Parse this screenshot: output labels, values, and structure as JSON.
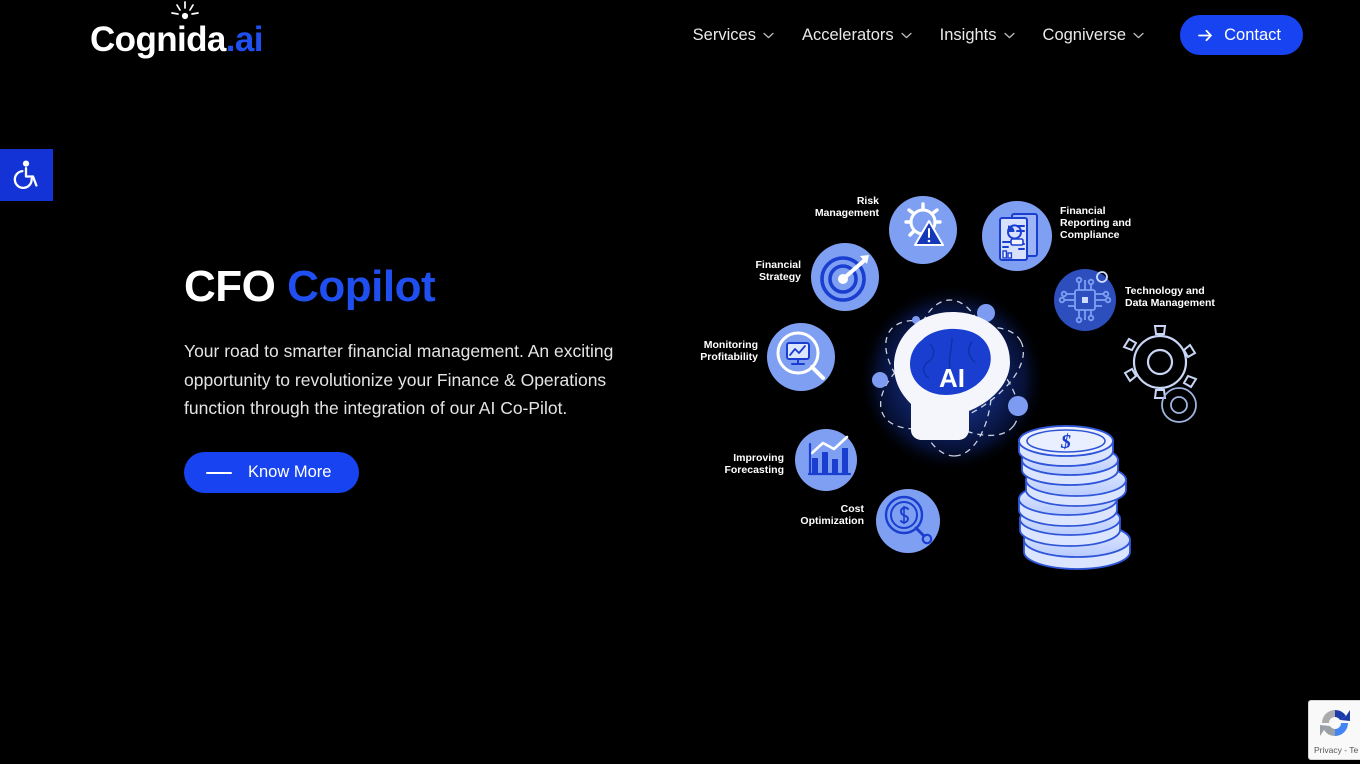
{
  "brand": {
    "name_main": "Cognida",
    "name_suffix": ".ai",
    "burst_icon": "sunburst-icon",
    "accent_color": "#1f4ff0"
  },
  "nav": {
    "items": [
      {
        "label": "Services",
        "icon": "chevron-down-icon"
      },
      {
        "label": "Accelerators",
        "icon": "chevron-down-icon"
      },
      {
        "label": "Insights",
        "icon": "chevron-down-icon"
      },
      {
        "label": "Cogniverse",
        "icon": "chevron-down-icon"
      }
    ],
    "contact": {
      "label": "Contact",
      "icon": "arrow-right-icon"
    }
  },
  "accessibility": {
    "icon": "wheelchair-accessibility-icon",
    "background": "#1433d6"
  },
  "hero": {
    "title_plain": "CFO",
    "title_accent": "Copilot",
    "paragraph": "Your road to smarter financial management. An exciting opportunity to revolutionize your Finance & Operations function through the integration of our AI Co-Pilot.",
    "cta": {
      "label": "Know More",
      "icon": "dash-icon"
    }
  },
  "illustration": {
    "center_label": "AI",
    "center_icon": "brain-head-icon",
    "coins_icon": "coin-stack-dollar-icon",
    "gear_icon": "gear-outline-icon",
    "nodes": [
      {
        "label": "Risk Management",
        "icon": "gear-warning-icon",
        "label_align": "right"
      },
      {
        "label": "Financial Strategy",
        "icon": "target-dart-icon",
        "label_align": "right"
      },
      {
        "label": "Financial Reporting and Compliance",
        "icon": "report-document-icon",
        "label_align": "left"
      },
      {
        "label": "Technology and Data Management",
        "icon": "circuit-chip-icon",
        "label_align": "left"
      },
      {
        "label": "Monitoring Profitability",
        "icon": "magnifier-monitor-icon",
        "label_align": "right"
      },
      {
        "label": "Improving Forecasting",
        "icon": "bar-chart-trend-icon",
        "label_align": "right"
      },
      {
        "label": "Cost Optimization",
        "icon": "magnifier-dollar-icon",
        "label_align": "right"
      }
    ]
  },
  "recaptcha": {
    "icon": "recaptcha-logo-icon",
    "text": "Privacy - Te"
  }
}
